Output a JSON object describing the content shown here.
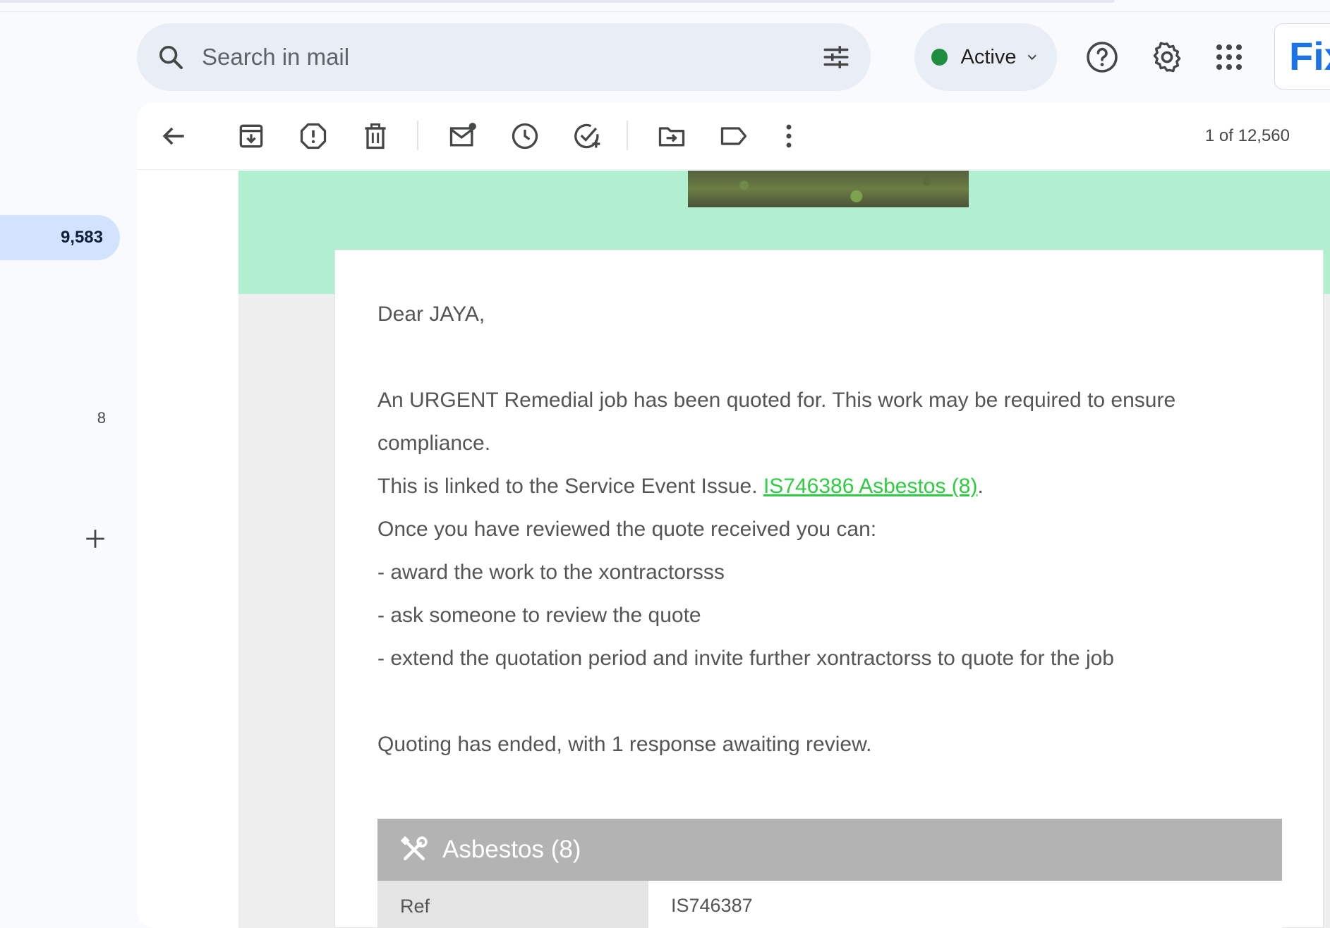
{
  "search": {
    "placeholder": "Search in mail"
  },
  "status": {
    "label": "Active",
    "color": "#1e8e3e"
  },
  "header": {
    "brand_text": "Fix"
  },
  "rail": {
    "inbox_count": "9,583",
    "small_count": "8"
  },
  "toolbar": {
    "pager": "1 of 12,560"
  },
  "email": {
    "greeting": "Dear JAYA,",
    "para1": "An URGENT Remedial job has been quoted for. This work may be required to ensure compliance.",
    "linked_prefix": "This is linked to the Service Event Issue.",
    "link_text": "IS746386 Asbestos (8)",
    "linked_suffix": ".",
    "review_intro": "Once you have reviewed the quote received you can:",
    "options": [
      "- award the work to the xontractorsss",
      "- ask someone to review the quote",
      "- extend the quotation period and invite further xontractorss to quote for the job"
    ],
    "quoting_status": "Quoting has ended, with 1 response awaiting review.",
    "job": {
      "title": "Asbestos (8)",
      "rows": [
        {
          "label": "Ref",
          "value": "IS746387"
        }
      ]
    }
  },
  "colors": {
    "accent_mint": "#b1efd1",
    "link_green": "#2ecc40",
    "rail_highlight": "#d3e3fd"
  }
}
